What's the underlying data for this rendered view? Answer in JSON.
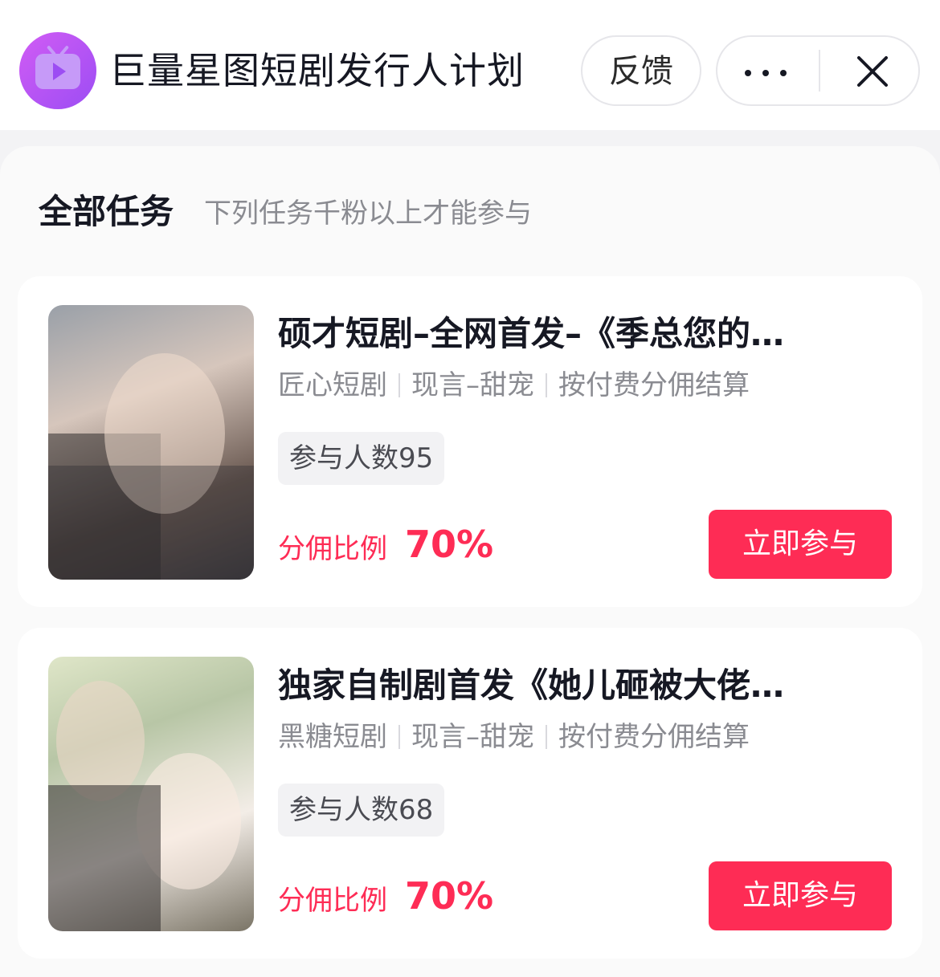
{
  "header": {
    "app_title": "巨量星图短剧发行人计划",
    "feedback_label": "反馈",
    "more_icon": "more-horizontal-icon",
    "close_icon": "close-icon",
    "logo_icon": "tv-play-icon"
  },
  "section": {
    "title": "全部任务",
    "subtitle": "下列任务千粉以上才能参与"
  },
  "tasks": [
    {
      "title": "硕才短剧–全网首发–《季总您的…",
      "tags": [
        "匠心短剧",
        "现言–甜宠",
        "按付费分佣结算"
      ],
      "participants": "参与人数95",
      "commission_label": "分佣比例",
      "commission_value": "70%",
      "button_label": "立即参与"
    },
    {
      "title": "独家自制剧首发《她儿砸被大佬…",
      "tags": [
        "黑糖短剧",
        "现言–甜宠",
        "按付费分佣结算"
      ],
      "participants": "参与人数68",
      "commission_label": "分佣比例",
      "commission_value": "70%",
      "button_label": "立即参与"
    }
  ],
  "colors": {
    "accent": "#fe2c55",
    "logo": "#a04ff4",
    "muted_text": "#8a8b91"
  }
}
